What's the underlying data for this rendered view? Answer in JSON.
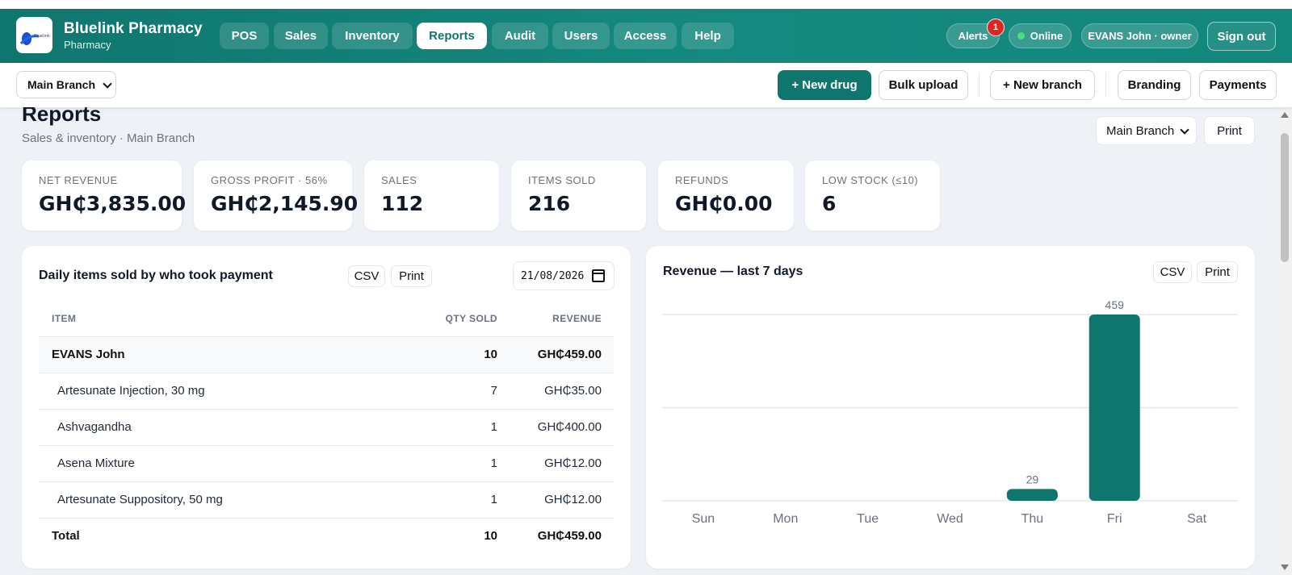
{
  "header": {
    "brand_name": "Bluelink Pharmacy",
    "brand_sub": "Pharmacy",
    "nav": [
      "POS",
      "Sales",
      "Inventory",
      "Reports",
      "Audit",
      "Users",
      "Access",
      "Help"
    ],
    "active_nav": "Reports",
    "alerts_label": "Alerts",
    "alerts_count": "1",
    "status": "Online",
    "user": "EVANS John · owner",
    "sign_out": "Sign out"
  },
  "toolbar": {
    "branch": "Main Branch",
    "new_drug": "+ New drug",
    "bulk_upload": "Bulk upload",
    "new_branch": "+ New branch",
    "branding": "Branding",
    "payments": "Payments"
  },
  "page": {
    "title": "Reports",
    "subtitle": "Sales & inventory · Main Branch",
    "branch_select": "Main Branch",
    "print": "Print"
  },
  "cards": [
    {
      "label": "NET REVENUE",
      "value": "GH₵3,835.00"
    },
    {
      "label": "GROSS PROFIT · 56%",
      "value": "GH₵2,145.90"
    },
    {
      "label": "SALES",
      "value": "112"
    },
    {
      "label": "ITEMS SOLD",
      "value": "216"
    },
    {
      "label": "REFUNDS",
      "value": "GH₵0.00"
    },
    {
      "label": "LOW STOCK (≤10)",
      "value": "6"
    }
  ],
  "daily_panel": {
    "title": "Daily items sold by who took payment",
    "csv": "CSV",
    "print": "Print",
    "date": "21/08/2026",
    "columns": [
      "ITEM",
      "QTY SOLD",
      "REVENUE"
    ],
    "group": {
      "name": "EVANS John",
      "qty": "10",
      "revenue": "GH₵459.00"
    },
    "rows": [
      {
        "item": "Artesunate Injection, 30 mg",
        "qty": "7",
        "revenue": "GH₵35.00"
      },
      {
        "item": "Ashvagandha",
        "qty": "1",
        "revenue": "GH₵400.00"
      },
      {
        "item": "Asena Mixture",
        "qty": "1",
        "revenue": "GH₵12.00"
      },
      {
        "item": "Artesunate Suppository, 50 mg",
        "qty": "1",
        "revenue": "GH₵12.00"
      }
    ],
    "total": {
      "label": "Total",
      "qty": "10",
      "revenue": "GH₵459.00"
    }
  },
  "revenue_panel": {
    "title": "Revenue — last 7 days",
    "csv": "CSV",
    "print": "Print"
  },
  "chart_data": {
    "type": "bar",
    "title": "Revenue — last 7 days",
    "categories": [
      "Sun",
      "Mon",
      "Tue",
      "Wed",
      "Thu",
      "Fri",
      "Sat"
    ],
    "values": [
      0,
      0,
      0,
      0,
      29,
      459,
      0
    ],
    "data_labels": [
      "",
      "",
      "",
      "",
      "29",
      "459",
      ""
    ],
    "ylim": [
      0,
      459
    ],
    "grid": true,
    "bar_color": "#0f766e"
  },
  "colors": {
    "accent": "#0f766e",
    "alert": "#dc2626",
    "online": "#4ade80"
  }
}
